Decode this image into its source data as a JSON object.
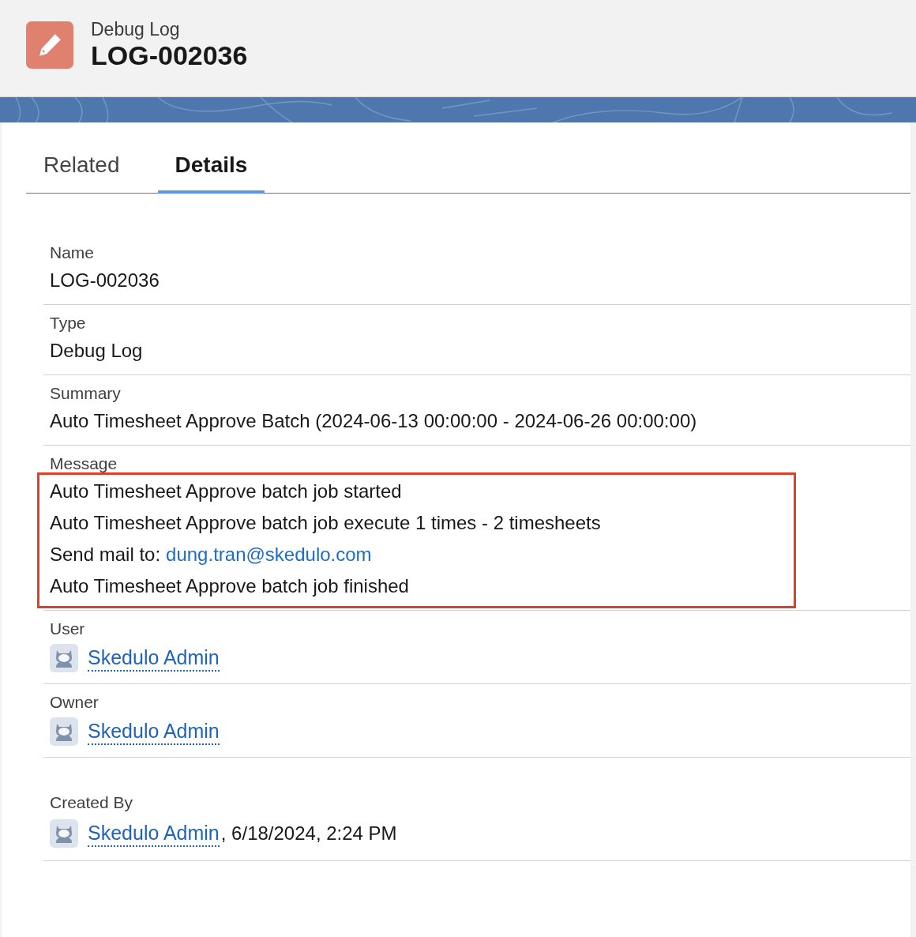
{
  "header": {
    "object_type": "Debug Log",
    "title": "LOG-002036"
  },
  "tabs": [
    {
      "label": "Related",
      "selected": false
    },
    {
      "label": "Details",
      "selected": true
    }
  ],
  "fields": [
    {
      "kind": "text",
      "label": "Name",
      "value": "LOG-002036"
    },
    {
      "kind": "text",
      "label": "Type",
      "value": "Debug Log"
    },
    {
      "kind": "text",
      "label": "Summary",
      "value": "Auto Timesheet Approve Batch (2024-06-13 00:00:00 - 2024-06-26 00:00:00)"
    },
    {
      "kind": "message",
      "label": "Message",
      "annotated": true,
      "lines": [
        {
          "text": "Auto Timesheet Approve batch job started"
        },
        {
          "text": "Auto Timesheet Approve batch job execute 1 times - 2 timesheets"
        },
        {
          "text": "Send mail to:",
          "link": "dung.tran@skedulo.com"
        },
        {
          "text": "Auto Timesheet Approve batch job finished"
        }
      ]
    },
    {
      "kind": "user",
      "label": "User",
      "link": "Skedulo Admin"
    },
    {
      "kind": "user",
      "label": "Owner",
      "link": "Skedulo Admin"
    },
    {
      "kind": "user",
      "label": "Created By",
      "link": "Skedulo Admin",
      "extra": ", 6/18/2024, 2:24 PM",
      "spaced": true
    }
  ]
}
